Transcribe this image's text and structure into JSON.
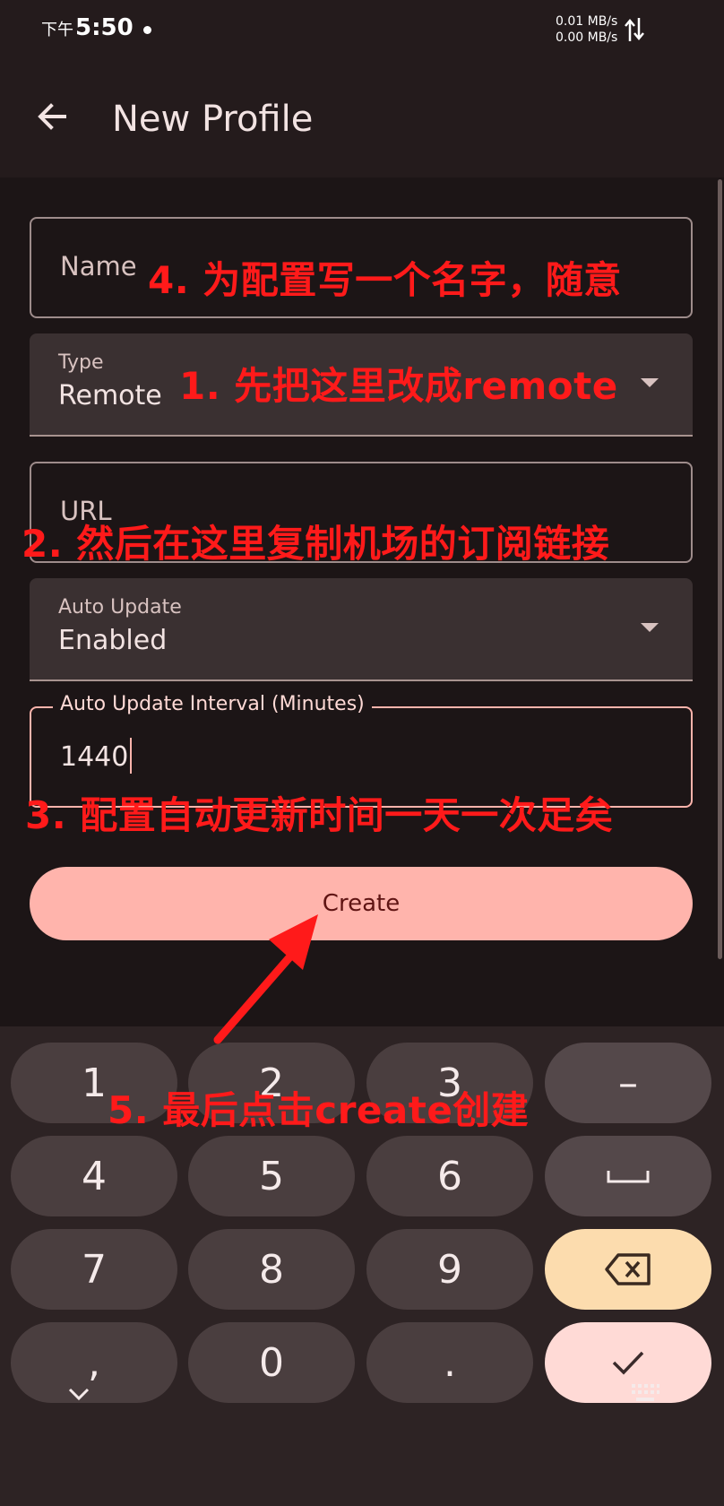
{
  "status_bar": {
    "ampm": "下午",
    "time": "5:50",
    "upload_speed": "0.01 MB/s",
    "download_speed": "0.00 MB/s"
  },
  "app_bar": {
    "title": "New Profile"
  },
  "form": {
    "name": {
      "label": "Name",
      "value": ""
    },
    "type": {
      "label": "Type",
      "value": "Remote"
    },
    "url": {
      "label": "URL",
      "value": ""
    },
    "auto_update": {
      "label": "Auto Update",
      "value": "Enabled"
    },
    "interval": {
      "label": "Auto Update Interval (Minutes)",
      "value": "1440"
    },
    "create_label": "Create"
  },
  "keyboard": {
    "keys": {
      "k1": "1",
      "k2": "2",
      "k3": "3",
      "minus": "–",
      "k4": "4",
      "k5": "5",
      "k6": "6",
      "k7": "7",
      "k8": "8",
      "k9": "9",
      "comma": ",",
      "k0": "0",
      "period": "."
    }
  },
  "annotations": {
    "step4": "4. 为配置写一个名字，随意",
    "step1": "1. 先把这里改成remote",
    "step2": "2. 然后在这里复制机场的订阅链接",
    "step3": "3. 配置自动更新时间一天一次足矣",
    "step5": "5. 最后点击create创建",
    "color": "#ff1a1a"
  },
  "colors": {
    "background": "#1c1516",
    "primary": "#ffb4ac",
    "on_primary": "#5f1413",
    "key": "#4a3e3f",
    "backspace_key": "#fcdcae",
    "enter_key": "#ffdad6"
  }
}
